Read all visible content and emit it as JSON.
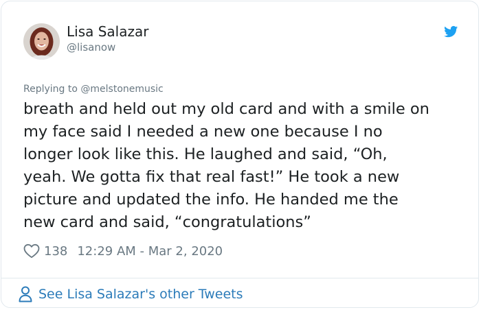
{
  "tweet": {
    "author": {
      "name": "Lisa Salazar",
      "handle": "@lisanow"
    },
    "reply_prefix": "Replying to ",
    "reply_to": "@melstonemusic",
    "lines": [
      "breath and held out my old card and with a smile on",
      "my face said I needed a new one because I no",
      "longer look like this. He laughed and said, “Oh,",
      "yeah. We gotta fix that real fast!” He took a new",
      "picture and updated the info. He handed me the",
      "new card and said, “congratulations”"
    ],
    "likes": "138",
    "timestamp": "12:29 AM - Mar 2, 2020",
    "footer_link": "See Lisa Salazar's other Tweets"
  },
  "colors": {
    "text": "#1c2022",
    "muted": "#697882",
    "link": "#2b7bb9",
    "twitter_blue": "#1da1f2",
    "border": "#e1e8ed"
  },
  "icons": {
    "brand": "twitter-bird-icon",
    "like": "heart-icon",
    "profile": "person-icon"
  }
}
